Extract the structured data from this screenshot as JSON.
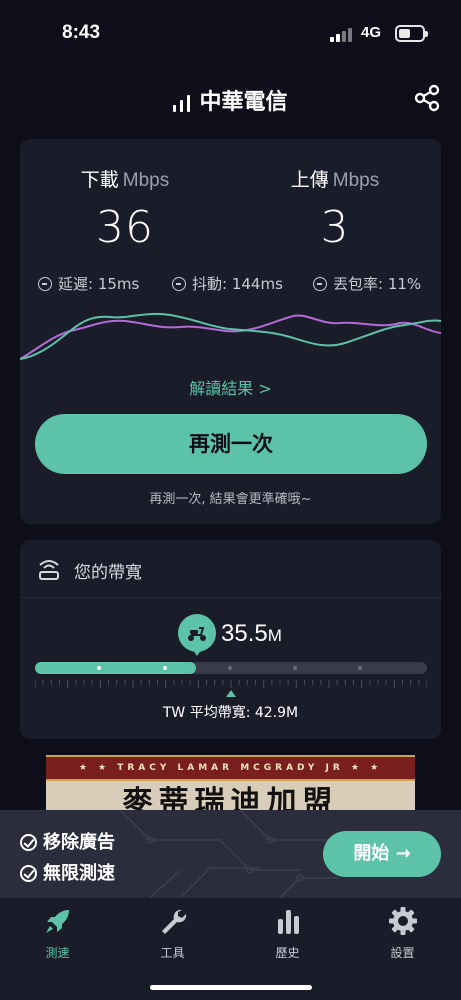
{
  "status": {
    "time": "8:43",
    "network": "4G"
  },
  "header": {
    "carrier": "中華電信",
    "share_icon": "share-icon"
  },
  "result": {
    "download": {
      "label": "下載",
      "unit": "Mbps",
      "value": "36"
    },
    "upload": {
      "label": "上傳",
      "unit": "Mbps",
      "value": "3"
    },
    "latency": "延遲: 15ms",
    "jitter": "抖動: 144ms",
    "packet_loss": "丟包率: 11%",
    "interpret_link": "解讀結果 >",
    "retest_button": "再測一次",
    "hint": "再測一次, 結果會更準確哦~",
    "colors": {
      "download_line": "#5cc2a8",
      "upload_line": "#b46ad6"
    }
  },
  "bandwidth": {
    "title": "您的帶寬",
    "speed_value": "35.5",
    "speed_unit": "M",
    "level_fraction": 0.41,
    "average_label": "TW 平均帶寬: 42.9M"
  },
  "ad": {
    "strip_text": "★ ★ TRACY LAMAR MCGRADY JR ★ ★",
    "big_text": "麥蒂瑞迪加盟"
  },
  "promo": {
    "item1": "移除廣告",
    "item2": "無限測速",
    "start_button": "開始 →"
  },
  "tabs": [
    {
      "label": "測速",
      "icon": "rocket-icon",
      "active": true
    },
    {
      "label": "工具",
      "icon": "wrench-icon",
      "active": false
    },
    {
      "label": "歷史",
      "icon": "bar-chart-icon",
      "active": false
    },
    {
      "label": "設置",
      "icon": "gear-icon",
      "active": false
    }
  ],
  "theme": {
    "accent": "#5cc2a8",
    "background": "#0e0e1a",
    "card": "#1b1c2a"
  }
}
